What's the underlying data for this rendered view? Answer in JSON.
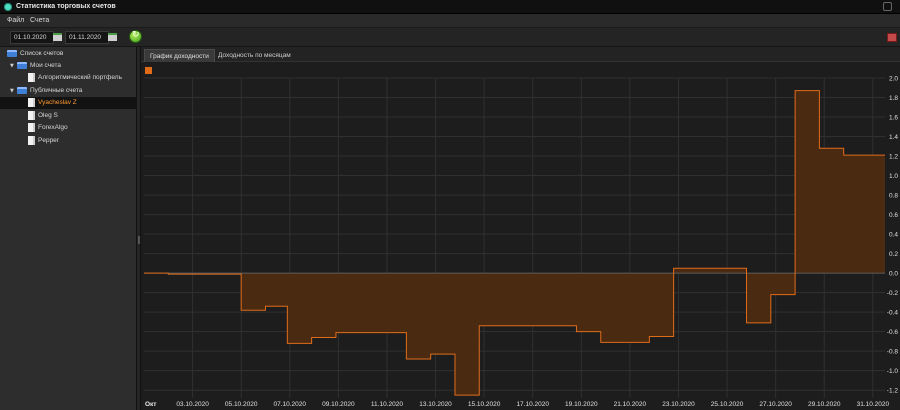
{
  "window": {
    "title": "Статистика торговых счетов"
  },
  "menu": {
    "items": [
      "Файл",
      "Счета"
    ]
  },
  "toolbar": {
    "date_from": "01.10.2020",
    "date_to": "01.11.2020"
  },
  "tree": {
    "root": "Список счетов",
    "groups": [
      {
        "label": "Мои счета",
        "children": [
          "Алгоритмический портфель"
        ]
      },
      {
        "label": "Публичные счета",
        "children": [
          "Vyacheslav Z",
          "Oleg S",
          "ForexAlgo",
          "Pepper"
        ]
      }
    ],
    "selected": "Vyacheslav Z"
  },
  "tabs": [
    {
      "label": "График доходности",
      "active": true
    },
    {
      "label": "Доходность по месяцам",
      "active": false
    }
  ],
  "colors": {
    "series": "#e06c1a",
    "fill": "#4a2a10",
    "selection": "#ff9a2e",
    "grid": "#303030"
  },
  "chart_data": {
    "type": "area",
    "step": true,
    "x_label_first": "Окт",
    "x_tick_labels": [
      "03.10.2020",
      "05.10.2020",
      "07.10.2020",
      "09.10.2020",
      "11.10.2020",
      "13.10.2020",
      "15.10.2020",
      "17.10.2020",
      "19.10.2020",
      "21.10.2020",
      "23.10.2020",
      "25.10.2020",
      "27.10.2020",
      "29.10.2020",
      "31.10.2020"
    ],
    "y_ticks": [
      "2.0",
      "1.8",
      "1.6",
      "1.4",
      "1.2",
      "1.0",
      "0.8",
      "0.6",
      "0.4",
      "0.2",
      "0.0",
      "-0.2",
      "-0.4",
      "-0.6",
      "-0.8",
      "-1.0",
      "-1.2"
    ],
    "ylim": [
      -1.28,
      2.0
    ],
    "xlim": [
      1,
      31.5
    ],
    "points": [
      {
        "x": 1.0,
        "y": 0.0
      },
      {
        "x": 2.0,
        "y": -0.01
      },
      {
        "x": 5.0,
        "y": -0.38
      },
      {
        "x": 6.0,
        "y": -0.34
      },
      {
        "x": 6.9,
        "y": -0.72
      },
      {
        "x": 7.9,
        "y": -0.66
      },
      {
        "x": 8.9,
        "y": -0.61
      },
      {
        "x": 11.8,
        "y": -0.88
      },
      {
        "x": 12.8,
        "y": -0.83
      },
      {
        "x": 13.8,
        "y": -1.25
      },
      {
        "x": 14.8,
        "y": -0.54
      },
      {
        "x": 18.8,
        "y": -0.6
      },
      {
        "x": 19.8,
        "y": -0.71
      },
      {
        "x": 21.8,
        "y": -0.65
      },
      {
        "x": 22.8,
        "y": 0.05
      },
      {
        "x": 25.8,
        "y": -0.51
      },
      {
        "x": 26.8,
        "y": -0.22
      },
      {
        "x": 27.8,
        "y": 1.87
      },
      {
        "x": 28.8,
        "y": 1.28
      },
      {
        "x": 29.8,
        "y": 1.21
      }
    ],
    "grid": true
  }
}
